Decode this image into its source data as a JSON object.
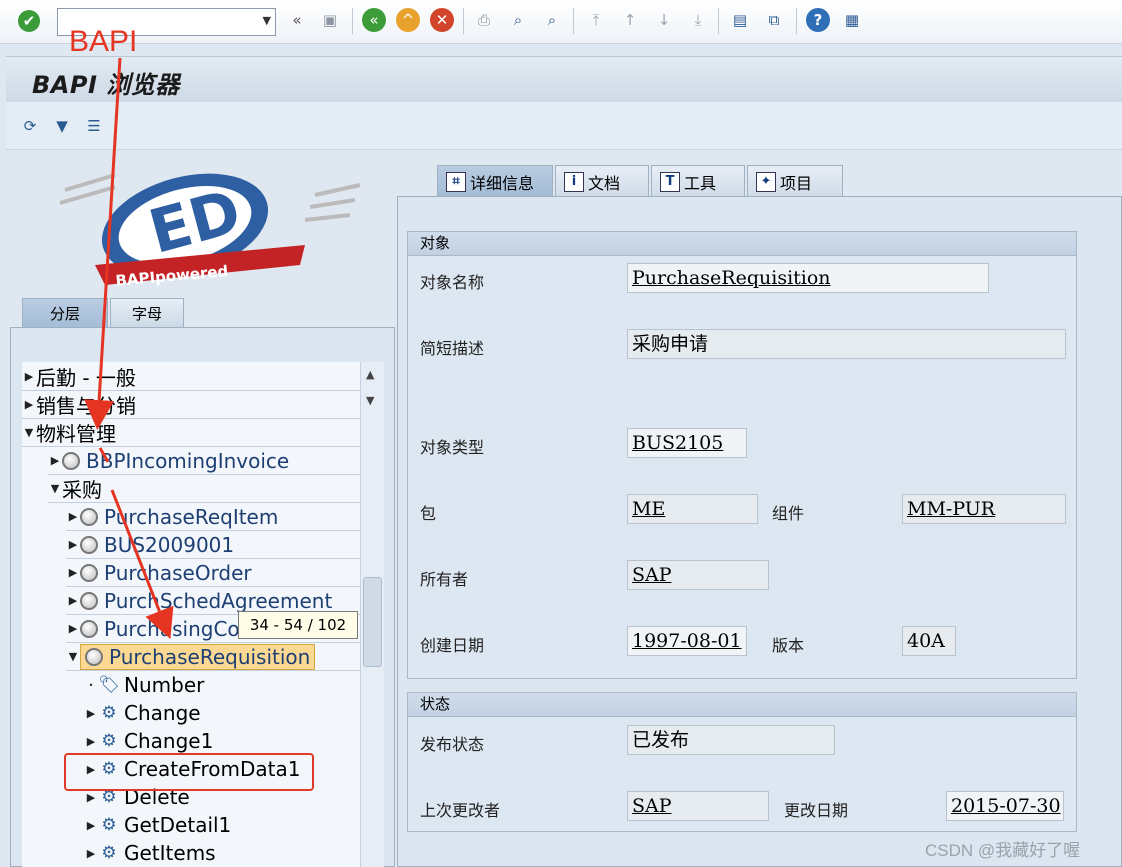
{
  "title": "BAPI 浏览器",
  "toolbar": {
    "icons": [
      "check-icon",
      "dropdown-arrow",
      "back-double-icon",
      "save-icon",
      "back-icon",
      "exit-icon",
      "cancel-icon",
      "print-icon",
      "find-icon",
      "find-next-icon",
      "first-page-icon",
      "prev-page-icon",
      "next-page-icon",
      "last-page-icon",
      "new-session-icon",
      "shortcut-icon",
      "help-icon",
      "customize-icon"
    ]
  },
  "left_tabs": [
    "分层",
    "字母"
  ],
  "tree": {
    "rows": [
      {
        "label": "后勤 - 一般",
        "level": 0,
        "state": "collapsed"
      },
      {
        "label": "销售与分销",
        "level": 0,
        "state": "collapsed"
      },
      {
        "label": "物料管理",
        "level": 0,
        "state": "expanded"
      },
      {
        "label": "BBPIncomingInvoice",
        "level": 1,
        "state": "collapsed",
        "kind": "object"
      },
      {
        "label": "采购",
        "level": 1,
        "state": "expanded"
      },
      {
        "label": "PurchaseReqItem",
        "level": 2,
        "state": "collapsed",
        "kind": "object"
      },
      {
        "label": "BUS2009001",
        "level": 2,
        "state": "collapsed",
        "kind": "object"
      },
      {
        "label": "PurchaseOrder",
        "level": 2,
        "state": "collapsed",
        "kind": "object"
      },
      {
        "label": "PurchSchedAgreement",
        "level": 2,
        "state": "collapsed",
        "kind": "object"
      },
      {
        "label": "PurchasingCo",
        "level": 2,
        "state": "collapsed",
        "kind": "object"
      },
      {
        "label": "PurchaseRequisition",
        "level": 2,
        "state": "expanded",
        "kind": "object",
        "selected": true
      },
      {
        "label": "Number",
        "level": 3,
        "state": "leaf",
        "kind": "key"
      },
      {
        "label": "Change",
        "level": 3,
        "state": "collapsed",
        "kind": "method"
      },
      {
        "label": "Change1",
        "level": 3,
        "state": "collapsed",
        "kind": "method"
      },
      {
        "label": "CreateFromData1",
        "level": 3,
        "state": "collapsed",
        "kind": "method"
      },
      {
        "label": "Delete",
        "level": 3,
        "state": "collapsed",
        "kind": "method"
      },
      {
        "label": "GetDetail1",
        "level": 3,
        "state": "collapsed",
        "kind": "method"
      },
      {
        "label": "GetItems",
        "level": 3,
        "state": "collapsed",
        "kind": "method"
      }
    ],
    "tooltip": "34 - 54 / 102"
  },
  "right_tabs": [
    {
      "label": "详细信息",
      "icon": "detail-icon"
    },
    {
      "label": "文档",
      "icon": "info-icon"
    },
    {
      "label": "工具",
      "icon": "tools-icon"
    },
    {
      "label": "项目",
      "icon": "project-icon"
    }
  ],
  "object_group": {
    "title": "对象",
    "fields": {
      "object_name": {
        "label": "对象名称",
        "value": "PurchaseRequisition"
      },
      "short_desc": {
        "label": "简短描述",
        "value": "采购申请"
      },
      "object_type": {
        "label": "对象类型",
        "value": "BUS2105"
      },
      "package": {
        "label": "包",
        "value": "ME"
      },
      "component": {
        "label": "组件",
        "value": "MM-PUR"
      },
      "owner": {
        "label": "所有者",
        "value": "SAP"
      },
      "created_on": {
        "label": "创建日期",
        "value": "1997-08-01"
      },
      "release": {
        "label": "版本",
        "value": "40A"
      }
    }
  },
  "status_group": {
    "title": "状态",
    "fields": {
      "release_status": {
        "label": "发布状态",
        "value": "已发布"
      },
      "last_changed_by": {
        "label": "上次更改者",
        "value": "SAP"
      },
      "changed_on": {
        "label": "更改日期",
        "value": "2015-07-30"
      }
    }
  },
  "annotation": {
    "label": "BAPI"
  },
  "logo": {
    "text": "BAPIpowered"
  },
  "watermark": "CSDN @我藏好了喔"
}
